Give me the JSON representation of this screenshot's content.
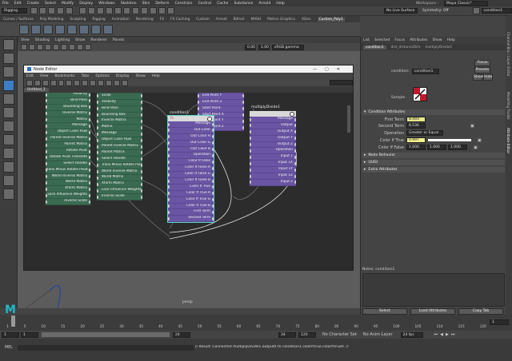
{
  "menubar": {
    "items": [
      "File",
      "Edit",
      "Create",
      "Select",
      "Modify",
      "Display",
      "Windows",
      "Skeleton",
      "Skin",
      "Deform",
      "Constrain",
      "Control",
      "Cache",
      "Substance",
      "Arnold",
      "Help"
    ],
    "workspace_label": "Workspace :",
    "workspace_value": "Maya Classic*"
  },
  "toolbar": {
    "menuset": "Rigging",
    "no_live_surface": "No Live Surface",
    "symmetry": "Symmetry: Off",
    "object_field": "condition1"
  },
  "shelf": {
    "tabs": [
      "Curves / Surfaces",
      "Poly Modeling",
      "Sculpting",
      "Rigging",
      "Animation",
      "Rendering",
      "FX",
      "FX Caching",
      "Custom",
      "Arnold",
      "Bifrost",
      "MASH",
      "Motion Graphics",
      "XGen",
      "Custom_Poly1"
    ],
    "active_tab": "Custom_Poly1"
  },
  "viewport": {
    "menu": [
      "View",
      "Shading",
      "Lighting",
      "Show",
      "Renderer",
      "Panels"
    ],
    "exposure": "0.00",
    "gamma": "1.00",
    "color_space": "sRGB gamma",
    "camera_label": "persp"
  },
  "node_editor": {
    "title": "Node Editor",
    "menu": [
      "Edit",
      "View",
      "Bookmarks",
      "Tabs",
      "Options",
      "Display",
      "Show",
      "Help"
    ],
    "tab": "Untitled_1",
    "nodes": {
      "left_green": {
        "attrs": [
          "Visibility",
          "Bind Pose",
          "Bounding Box",
          "Inverse Matrix",
          "Matrix",
          "Message",
          "Object Color RGB",
          "Parent Inverse Matrix",
          "Parent Matrix",
          "Rotate Pivot",
          "Rotate Pivot Translate",
          "Select Handle",
          "Trans Minus Rotate Pivot",
          "World Inverse Matrix",
          "World Matrix",
          "Xform Matrix",
          "Lock Influence Weights",
          "Inverse Scale"
        ]
      },
      "mid_green": {
        "attrs": [
          "Rotate",
          "Scale",
          "Visibility",
          "Bind Pose",
          "Bounding Box",
          "Inverse Matrix",
          "Matrix",
          "Message",
          "Object Color RGB",
          "Parent Inverse Matrix",
          "Parent Matrix",
          "Select Handle",
          "Trans Minus Rotate Pivot",
          "World Inverse Matrix",
          "World Matrix",
          "Xform Matrix",
          "Lock Influence Weights",
          "Inverse Scale"
        ]
      },
      "purple_top": {
        "attrs": [
          "End Point X",
          "End Point Y",
          "End Point Z",
          "Start Point",
          "Start Point X",
          "Start Point Y",
          "Start Point Z"
        ]
      },
      "condition": {
        "title": "condition1",
        "attrs": [
          "Message",
          "Out Color",
          "Out Color R",
          "Out Color G",
          "Out Color B",
          "Operation",
          "Color If False",
          "Color If False R",
          "Color If False G",
          "Color If False B",
          "Color If True",
          "Color If True R",
          "Color If True G",
          "Color If True B",
          "First Term",
          "Second Term"
        ]
      },
      "multiply": {
        "title": "multiplyDivide1",
        "attrs": [
          "Message",
          "Output",
          "Output X",
          "Output Y",
          "Output Z",
          "Operation",
          "Input 1",
          "Input 1X",
          "Input 1Y",
          "Input 1Z",
          "Input 2"
        ]
      }
    }
  },
  "attribute_editor": {
    "menu": [
      "List",
      "Selected",
      "Focus",
      "Attributes",
      "Show",
      "Help"
    ],
    "tabs": [
      "condition1",
      "dist_distanceDim",
      "multiplyDivide1"
    ],
    "active_tab": "condition1",
    "node_type_label": "condition:",
    "node_name": "condition1",
    "focus": "Focus",
    "presets": "Presets",
    "show": "Show",
    "hide": "Hide",
    "sample": "Sample",
    "section_condition": "Condition Attributes",
    "first_term_label": "First Term",
    "first_term": "8.493",
    "second_term_label": "Second Term",
    "second_term": "8.536",
    "operation_label": "Operation",
    "operation": "Greater or Equal",
    "color_true_label": "Color If True",
    "color_true": "0.997",
    "color_false_label": "Color If False",
    "color_false": [
      "1.000",
      "1.000",
      "1.000"
    ],
    "sections": [
      "Node Behavior",
      "UUID",
      "Extra Attributes"
    ],
    "notes_label": "Notes:  condition1",
    "buttons": [
      "Select",
      "Load Attributes",
      "Copy Tab"
    ]
  },
  "right_strip": [
    "Channel Box / Layer Editor",
    "Modelling Toolkit",
    "Attribute Editor"
  ],
  "timeline": {
    "ticks": [
      "1",
      "5",
      "10",
      "15",
      "20",
      "25",
      "30",
      "35",
      "40",
      "45",
      "50",
      "55",
      "60",
      "65",
      "70",
      "75",
      "80",
      "85",
      "90",
      "95",
      "100",
      "105",
      "110",
      "115",
      "120"
    ],
    "current_frame": "1",
    "range_start": "1",
    "range_start_inner": "1",
    "range_end_inner": "24",
    "range_end": "120",
    "range_end2": "200",
    "current_field": "34",
    "character_set": "No Character Set",
    "anim_layer": "No Anim Layer",
    "fps": "24 fps"
  },
  "command": {
    "lang": "MEL",
    "result": "// Result: Connected multiplyDivide1.outputX to condition1.colorIfTrue.colorIfTrueR. //"
  },
  "colors": {
    "node_green": "#3a6b52",
    "node_purple": "#6a55a4",
    "selection": "#5ad4c8",
    "first_term_field": "#e6e68a",
    "color_true_field": "#f0f08a"
  }
}
